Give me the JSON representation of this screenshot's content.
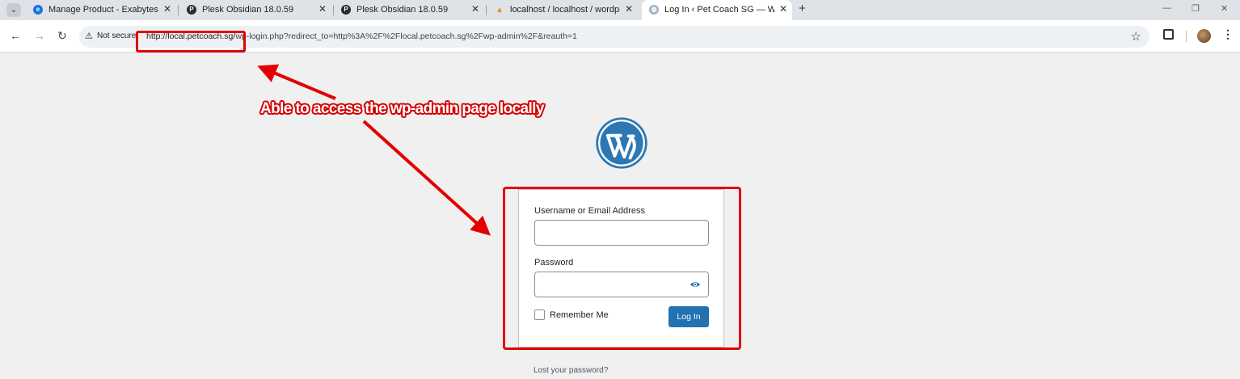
{
  "browser": {
    "tabs": [
      {
        "title": "Manage Product - Exabytes Net",
        "icon": "exabytes-icon",
        "active": false
      },
      {
        "title": "Plesk Obsidian 18.0.59",
        "icon": "plesk-icon",
        "active": false
      },
      {
        "title": "Plesk Obsidian 18.0.59",
        "icon": "plesk-icon",
        "active": false
      },
      {
        "title": "localhost / localhost / wordpress",
        "icon": "phpmyadmin-icon",
        "active": false
      },
      {
        "title": "Log In ‹ Pet Coach SG — Wordl",
        "icon": "globe-icon",
        "active": true
      }
    ],
    "address_bar": {
      "security_label": "Not secure",
      "url_host": "http://local.petcoach.sg/",
      "url_rest": "wp-login.php?redirect_to=http%3A%2F%2Flocal.petcoach.sg%2Fwp-admin%2F&reauth=1"
    }
  },
  "login_form": {
    "username_label": "Username or Email Address",
    "username_value": "",
    "password_label": "Password",
    "password_value": "",
    "remember_label": "Remember Me",
    "submit_label": "Log In",
    "lost_password_link": "Lost your password?"
  },
  "annotation": {
    "text": "Able to access the wp-admin page locally",
    "color": "#e30000"
  },
  "colors": {
    "wp_blue": "#2271b1",
    "logo_blue": "#2d78b2"
  }
}
